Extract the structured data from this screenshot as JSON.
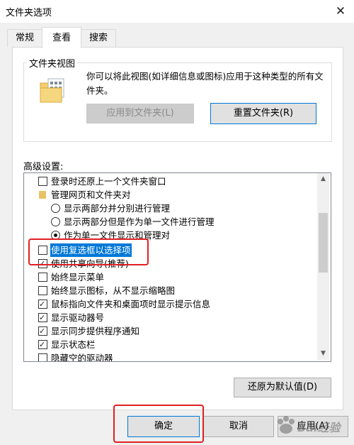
{
  "window": {
    "title": "文件夹选项",
    "close_glyph": "✕"
  },
  "tabs": [
    {
      "label": "常规",
      "active": false
    },
    {
      "label": "查看",
      "active": true
    },
    {
      "label": "搜索",
      "active": false
    }
  ],
  "folder_views": {
    "title": "文件夹视图",
    "description": "你可以将此视图(如详细信息或图标)应用于这种类型的所有文件夹。",
    "apply_button": "应用到文件夹(L)",
    "reset_button": "重置文件夹(R)"
  },
  "advanced": {
    "label": "高级设置:",
    "items": [
      {
        "type": "checkbox",
        "checked": false,
        "label": "登录时还原上一个文件夹窗口"
      },
      {
        "type": "folder",
        "label": "管理网页和文件夹对"
      },
      {
        "type": "radio",
        "checked": false,
        "label": "显示两部分并分别进行管理"
      },
      {
        "type": "radio",
        "checked": false,
        "label": "显示两部分但是作为单一文件进行管理"
      },
      {
        "type": "radio",
        "checked": true,
        "label": "作为单一文件显示和管理对"
      },
      {
        "type": "checkbox",
        "checked": false,
        "label": "使用复选框以选择项",
        "selected": true
      },
      {
        "type": "checkbox",
        "checked": true,
        "label": "使用共享向导(推荐)"
      },
      {
        "type": "checkbox",
        "checked": false,
        "label": "始终显示菜单"
      },
      {
        "type": "checkbox",
        "checked": false,
        "label": "始终显示图标，从不显示缩略图"
      },
      {
        "type": "checkbox",
        "checked": true,
        "label": "鼠标指向文件夹和桌面项时显示提示信息"
      },
      {
        "type": "checkbox",
        "checked": true,
        "label": "显示驱动器号"
      },
      {
        "type": "checkbox",
        "checked": true,
        "label": "显示同步提供程序通知"
      },
      {
        "type": "checkbox",
        "checked": true,
        "label": "显示状态栏"
      },
      {
        "type": "checkbox",
        "checked": false,
        "label": "隐藏空的驱动器"
      }
    ],
    "restore_button": "还原为默认值(D)"
  },
  "footer": {
    "ok_button": "确定",
    "cancel_button": "取消",
    "apply_button": "应用(A)"
  },
  "icons": {
    "scroll_up": "▲",
    "scroll_down": "▼"
  },
  "watermark": "Baidu 经验",
  "colors": {
    "accent": "#0078d7",
    "annotation": "#e02020"
  }
}
